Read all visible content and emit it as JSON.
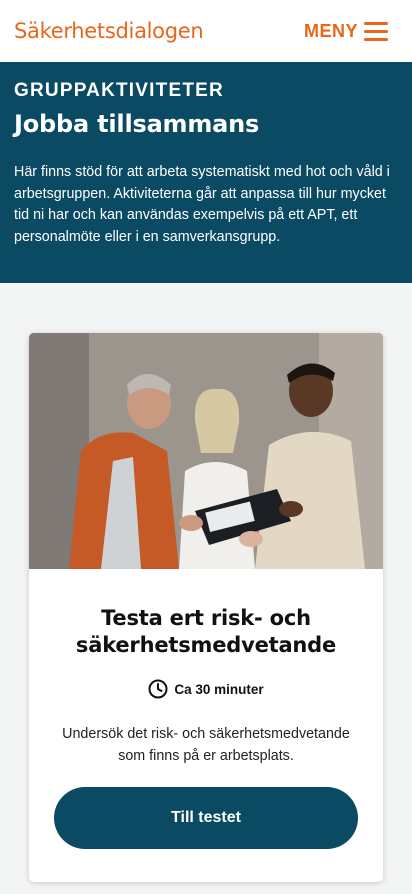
{
  "header": {
    "logo": "Säkerhetsdialogen",
    "menu_label": "MENY"
  },
  "hero": {
    "eyebrow": "GRUPPAKTIVITETER",
    "title": "Jobba tillsammans",
    "text": "Här finns stöd för att arbeta systematiskt med hot och våld i arbetsgruppen. Aktiviteterna går att anpassa till hur mycket tid ni har och kan användas exempelvis på ett APT, ett personalmöte eller i en samverkansgrupp."
  },
  "card": {
    "title": "Testa ert risk- och säkerhetsmedvetande",
    "duration": "Ca 30 minuter",
    "description": "Undersök det risk- och säkerhetsmedvetande som finns på er arbetsplats.",
    "button_label": "Till testet"
  },
  "colors": {
    "brand_orange": "#e8661a",
    "brand_teal": "#0b4a63"
  },
  "icons": {
    "menu": "hamburger-icon",
    "duration": "clock-icon"
  }
}
